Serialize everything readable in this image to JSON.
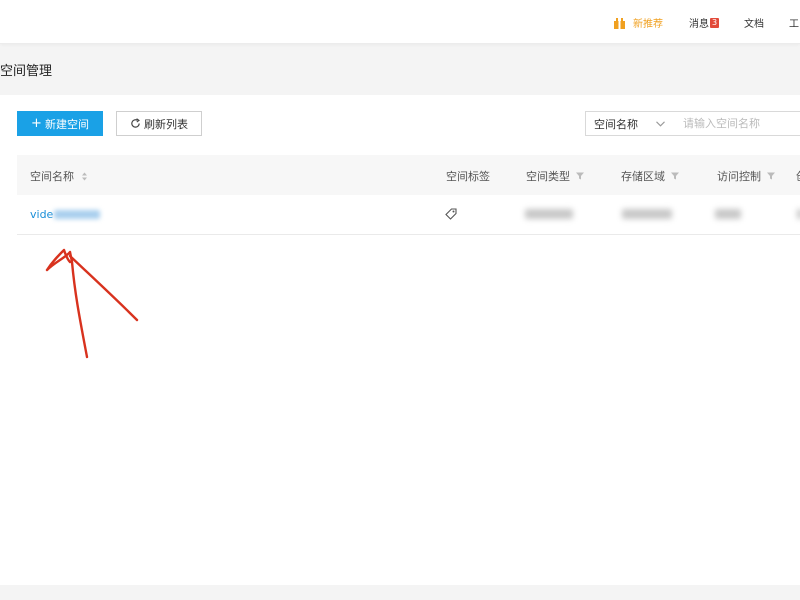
{
  "topnav": {
    "promo": {
      "label": "新推荐",
      "icon": "gift-icon",
      "color": "#f0a020"
    },
    "messages": {
      "label": "消息",
      "badge": "3"
    },
    "docs": {
      "label": "文档"
    },
    "tools": {
      "label": "工"
    }
  },
  "page": {
    "title": "空间管理"
  },
  "toolbar": {
    "create_label": "新建空间",
    "create_icon": "plus-icon",
    "refresh_label": "刷新列表",
    "refresh_icon": "refresh-icon",
    "search_field_option": "空间名称",
    "search_placeholder": "请输入空间名称"
  },
  "table": {
    "columns": [
      "空间名称",
      "空间标签",
      "空间类型",
      "存储区域",
      "访问控制",
      "创"
    ],
    "rows": [
      {
        "name_visible": "vide",
        "name_obscured": true,
        "tag_icon": "tag-icon",
        "type_obscured": true,
        "region_obscured": true,
        "acl_obscured": true
      }
    ]
  },
  "colors": {
    "primary": "#1aa1e6",
    "link": "#1a8fd8",
    "badge": "#e24a3a",
    "annotation": "#d8321e"
  },
  "annotation": {
    "icon": "hand-drawn-red-arrow-icon"
  }
}
